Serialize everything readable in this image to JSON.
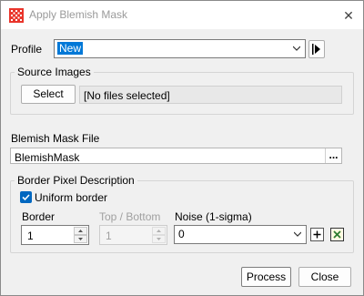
{
  "window": {
    "title": "Apply Blemish Mask",
    "close_label": "✕"
  },
  "profile": {
    "label": "Profile",
    "value": "New"
  },
  "source_images": {
    "group_title": "Source Images",
    "select_label": "Select",
    "files_text": "[No files selected]"
  },
  "blemish_mask_file": {
    "label": "Blemish Mask File",
    "value": "BlemishMask",
    "browse_label": "..."
  },
  "border_pixel": {
    "group_title": "Border Pixel Description",
    "uniform_label": "Uniform border",
    "uniform_checked": true,
    "border_label": "Border",
    "border_value": "1",
    "top_bottom_label": "Top / Bottom",
    "top_bottom_value": "1",
    "noise_label": "Noise (1-sigma)",
    "noise_value": "0"
  },
  "footer": {
    "process_label": "Process",
    "close_label": "Close"
  },
  "colors": {
    "accent": "#0078d7",
    "checkbox": "#0067c0",
    "clear_icon": "#2e7d32"
  },
  "icons": [
    "app-grid-icon",
    "close-icon",
    "chevron-down-icon",
    "play-icon",
    "checkmark-icon",
    "plus-icon",
    "clear-x-icon"
  ]
}
